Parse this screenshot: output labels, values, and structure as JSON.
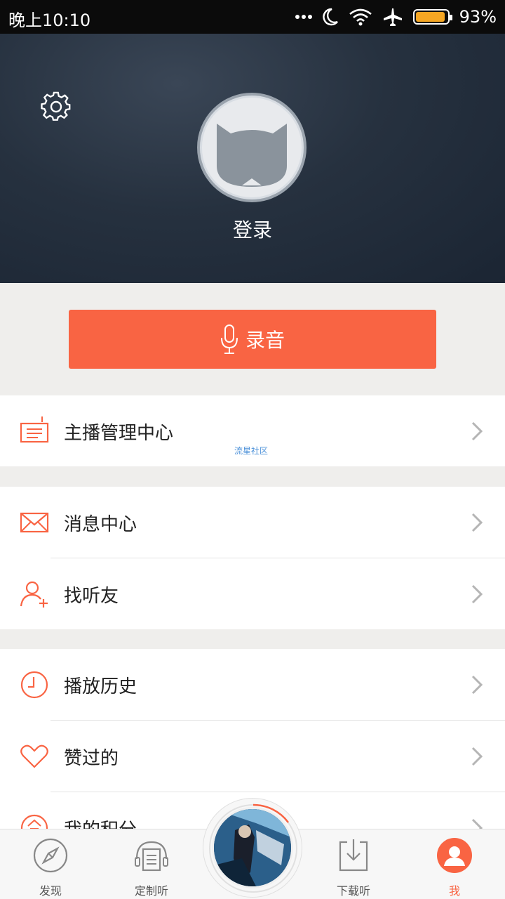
{
  "status": {
    "time": "晚上10:10",
    "battery": "93%",
    "battery_level": 0.93,
    "accent": "#f5a623"
  },
  "header": {
    "login": "登录"
  },
  "record": {
    "label": "录音"
  },
  "menu": [
    {
      "label": "主播管理中心",
      "sub": "流星社区"
    },
    {
      "label": "消息中心"
    },
    {
      "label": "找听友"
    },
    {
      "label": "播放历史"
    },
    {
      "label": "赞过的"
    },
    {
      "label": "我的积分"
    }
  ],
  "tabs": [
    {
      "label": "发现"
    },
    {
      "label": "定制听"
    },
    {
      "label": "下载听"
    },
    {
      "label": "我"
    }
  ],
  "colors": {
    "accent": "#f96443",
    "header": "#26313f"
  }
}
